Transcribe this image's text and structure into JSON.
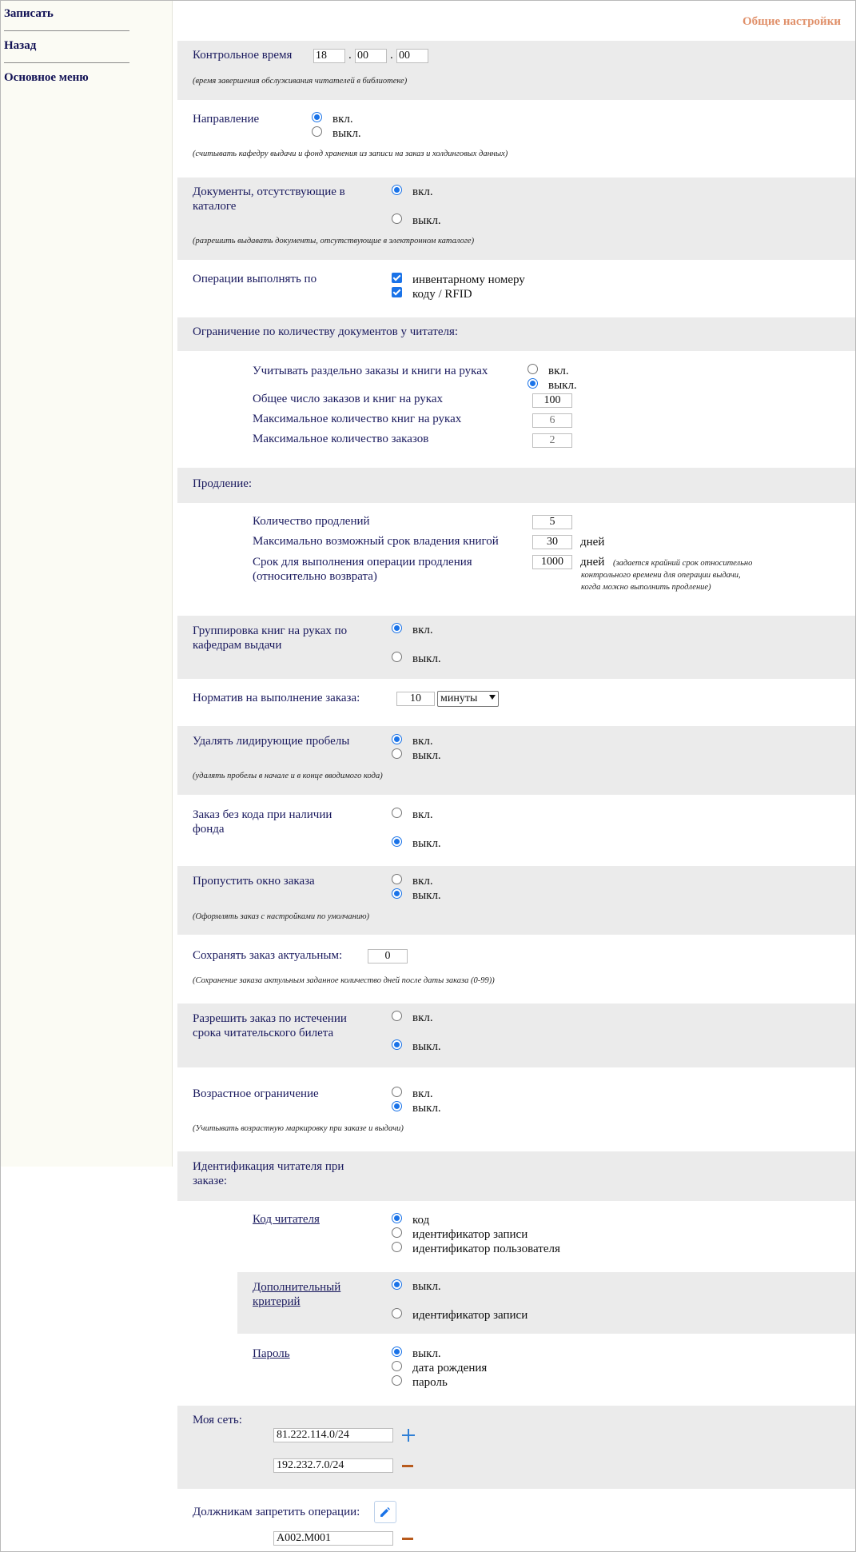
{
  "sidebar": {
    "items": [
      {
        "label": "Записать"
      },
      {
        "label": "Назад"
      },
      {
        "label": "Основное меню"
      }
    ]
  },
  "header": {
    "title": "Общие настройки"
  },
  "control_time": {
    "label": "Контрольное время",
    "hours": "18",
    "minutes": "00",
    "seconds": "00",
    "separator": ".",
    "hint": "(время завершения обслуживания читателей в библиотеке)"
  },
  "direction": {
    "label": "Направление",
    "on": "вкл.",
    "off": "выкл.",
    "selected": "on",
    "hint": "(считывать кафедру выдачи и фонд хранения из записи на заказ и холдинговых данных)"
  },
  "missing_docs": {
    "label": "Документы, отсутствующие в каталоге",
    "on": "вкл.",
    "off": "выкл.",
    "selected": "on",
    "hint": "(разрешить выдавать документы, отсутствующие в электронном каталоге)"
  },
  "operations_by": {
    "label": "Операции выполнять по",
    "options": [
      {
        "label": "инвентарному номеру",
        "checked": true
      },
      {
        "label": "коду / RFID",
        "checked": true
      }
    ]
  },
  "limit": {
    "title": "Ограничение по количеству документов у читателя:",
    "separate_label": "Учитывать раздельно заказы и книги на руках",
    "on": "вкл.",
    "off": "выкл.",
    "selected": "off",
    "total_label": "Общее число заказов и книг на руках",
    "total_value": "100",
    "max_books_label": "Максимальное количество книг на руках",
    "max_books_value": "6",
    "max_orders_label": "Максимальное количество заказов",
    "max_orders_value": "2"
  },
  "renewal": {
    "title": "Продление:",
    "count_label": "Количество продлений",
    "count_value": "5",
    "max_term_label": "Максимально возможный срок владения книгой",
    "max_term_value": "30",
    "max_term_unit": "дней",
    "op_term_label": "Срок для выполнения операции продления (относительно возврата)",
    "op_term_value": "1000",
    "op_term_unit": "дней",
    "op_term_hint": "(задается крайний срок относительно контрольного времени для операции выдачи, когда можно выполнить продление)"
  },
  "grouping": {
    "label": "Группировка книг на руках по кафедрам выдачи",
    "on": "вкл.",
    "off": "выкл.",
    "selected": "on"
  },
  "norm": {
    "label": "Норматив на выполнение заказа:",
    "value": "10",
    "unit": "минуты"
  },
  "trim_spaces": {
    "label": "Удалять лидирующие пробелы",
    "on": "вкл.",
    "off": "выкл.",
    "selected": "on",
    "hint": "(удалять пробелы в начале и в конце вводимого кода)"
  },
  "order_no_code": {
    "label": "Заказ без кода при наличии фонда",
    "on": "вкл.",
    "off": "выкл.",
    "selected": "off"
  },
  "skip_order": {
    "label": "Пропустить окно заказа",
    "on": "вкл.",
    "off": "выкл.",
    "selected": "off",
    "hint": "(Оформлять заказ с настройками по умолчанию)"
  },
  "keep_order": {
    "label": "Сохранять заказ актуальным:",
    "value": "0",
    "hint": "(Сохранение заказа актульным заданное количество дней после даты заказа (0-99))"
  },
  "expired_card": {
    "label": "Разрешить заказ по истечении срока читательского билета",
    "on": "вкл.",
    "off": "выкл.",
    "selected": "off"
  },
  "age_limit": {
    "label": "Возрастное ограничение",
    "on": "вкл.",
    "off": "выкл.",
    "selected": "off",
    "hint": "(Учитывать возрастную маркировку при заказе и выдачи)"
  },
  "identification": {
    "title": "Идентификация читателя при заказе:",
    "reader_code": {
      "label": "Код читателя",
      "options": [
        "код",
        "идентификатор записи",
        "идентификатор пользователя"
      ],
      "selected": 0
    },
    "extra": {
      "label": "Дополнительный критерий",
      "options": [
        "выкл.",
        "идентификатор записи"
      ],
      "selected": 0
    },
    "password": {
      "label": "Пароль",
      "options": [
        "выкл.",
        "дата рождения",
        "пароль"
      ],
      "selected": 0
    }
  },
  "my_network": {
    "label": "Моя сеть:",
    "entries": [
      "81.222.114.0/24",
      "192.232.7.0/24"
    ]
  },
  "debtors": {
    "label": "Должникам запретить операции:",
    "entries": [
      "A002.M001"
    ]
  },
  "icons": {
    "add": "plus-icon",
    "remove": "minus-icon",
    "edit": "pencil-icon"
  },
  "colors": {
    "title": "#e0906a",
    "link": "#1a1a5e",
    "band": "#ebebeb",
    "accent": "#1a73e8",
    "sidebar": "#fbfbf4"
  }
}
